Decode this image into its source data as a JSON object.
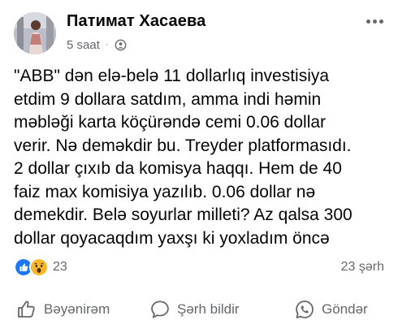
{
  "post": {
    "author": {
      "name": "Патимат Хасаева",
      "avatar_icon": "profile-photo"
    },
    "time": "5 saat",
    "separator": "·",
    "audience_icon": "friends-audience-icon",
    "more_icon": "more-options-icon",
    "text_lines": [
      "\"ABB\" dən elə-belə 11 dollarlıq investisiya",
      "etdim 9 dollara satdım, amma indi həmin",
      "məbləği karta köçürəndə cemi 0.06 dollar",
      "verir. Nə deməkdir bu. Treyder platformasıdı.",
      "2 dollar çıxıb da komisya haqqı. Hem de 40",
      "faiz max komisiya yazılıb. 0.06 dollar nə",
      "demekdir. Belə soyurlar milleti? Az qalsa 300",
      "dollar qoyacaqdım yaxşı ki yoxladım öncə"
    ]
  },
  "reactions": {
    "icons": [
      "like-reaction-icon",
      "wow-reaction-icon"
    ],
    "count": "23"
  },
  "shares": "23 şərh",
  "actions": {
    "like_label": "Bəyənirəm",
    "comment_label": "Şərh bildir",
    "share_label": "Göndər"
  },
  "colors": {
    "text": "#050505",
    "secondary": "#65676b",
    "like_blue": "#1877f2",
    "wow_yellow": "#f7b928"
  }
}
